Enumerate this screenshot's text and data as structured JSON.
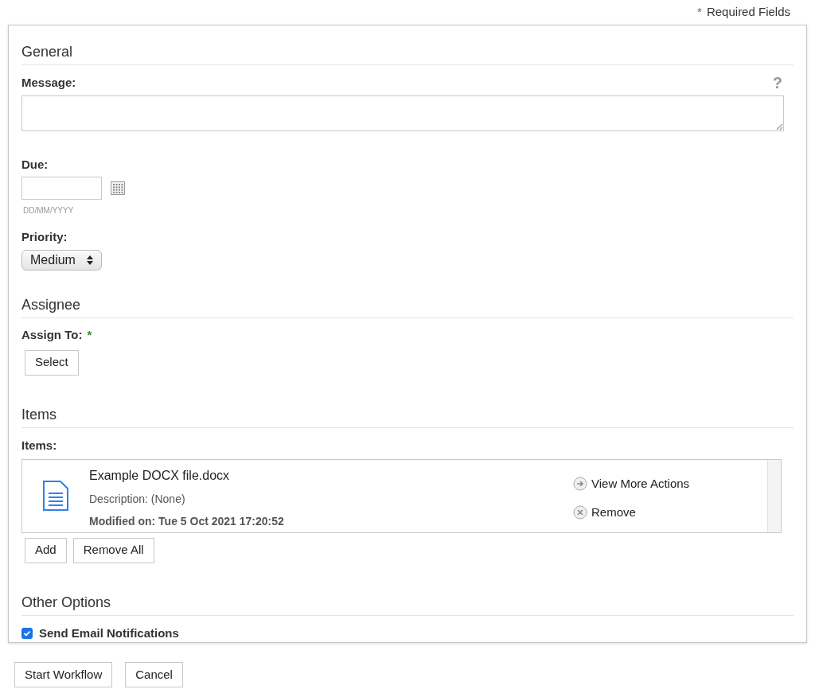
{
  "required_note": {
    "marker": "*",
    "label": "Required Fields"
  },
  "general": {
    "heading": "General",
    "message_label": "Message:",
    "help": "?",
    "due_label": "Due:",
    "due_hint": "DD/MM/YYYY",
    "priority_label": "Priority:",
    "priority_value": "Medium"
  },
  "assignee": {
    "heading": "Assignee",
    "assign_label": "Assign To:",
    "required_marker": "*",
    "select_button": "Select"
  },
  "items": {
    "heading": "Items",
    "label": "Items:",
    "files": [
      {
        "name": "Example DOCX file.docx",
        "description": "Description: (None)",
        "modified": "Modified on: Tue 5 Oct 2021 17:20:52",
        "actions": [
          {
            "kind": "more",
            "label": "View More Actions"
          },
          {
            "kind": "remove",
            "label": "Remove"
          }
        ]
      }
    ],
    "buttons": [
      "Add",
      "Remove All"
    ]
  },
  "other_options": {
    "heading": "Other Options",
    "send_email": {
      "label": "Send Email Notifications",
      "checked": true
    }
  },
  "footer_buttons": [
    "Start Workflow",
    "Cancel"
  ]
}
